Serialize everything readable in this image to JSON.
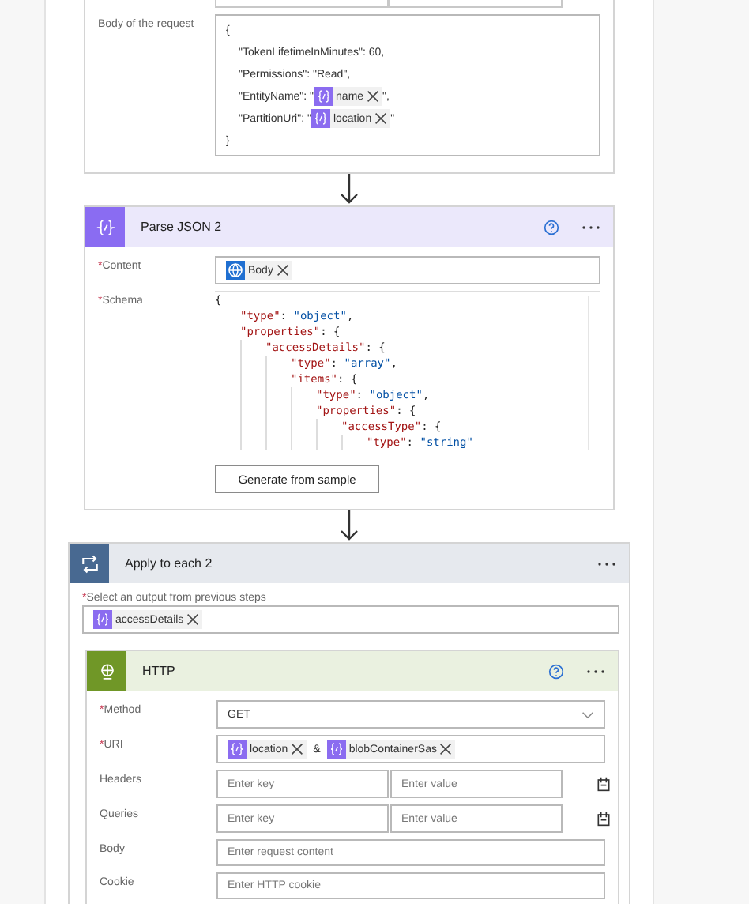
{
  "request_body": {
    "label": "Body of the request",
    "open": "{",
    "close": "}",
    "entries": [
      [
        {
          "kind": "text",
          "text": "\"TokenLifetimeInMinutes\": 60,"
        }
      ],
      [
        {
          "kind": "text",
          "text": "\"Permissions\": \"Read\","
        }
      ],
      [
        {
          "kind": "text",
          "text": "\"EntityName\": \""
        },
        {
          "kind": "expression",
          "text": "name"
        },
        {
          "kind": "text",
          "text": "\","
        }
      ],
      [
        {
          "kind": "text",
          "text": "\"PartitionUri\": \""
        },
        {
          "kind": "expression",
          "text": "location"
        },
        {
          "kind": "text",
          "text": "\""
        }
      ]
    ]
  },
  "parse_json": {
    "title": "Parse JSON 2",
    "button": "Generate from sample",
    "fields": [
      {
        "kind": "tokens",
        "label": "Content",
        "required_mark": "*",
        "parts": [
          {
            "kind": "globe",
            "text": "Body"
          }
        ]
      },
      {
        "kind": "code",
        "label": "Schema",
        "required_mark": "*",
        "tree": [
          {
            "parts": [
              {
                "kind": "punct",
                "text": "{"
              }
            ],
            "children": [
              {
                "parts": [
                  {
                    "kind": "key",
                    "text": "\"type\""
                  },
                  {
                    "kind": "punct",
                    "text": ": "
                  },
                  {
                    "kind": "value",
                    "text": "\"object\""
                  },
                  {
                    "kind": "punct",
                    "text": ","
                  }
                ]
              },
              {
                "parts": [
                  {
                    "kind": "key",
                    "text": "\"properties\""
                  },
                  {
                    "kind": "punct",
                    "text": ": {"
                  }
                ],
                "children": [
                  {
                    "parts": [
                      {
                        "kind": "key",
                        "text": "\"accessDetails\""
                      },
                      {
                        "kind": "punct",
                        "text": ": {"
                      }
                    ],
                    "children": [
                      {
                        "parts": [
                          {
                            "kind": "key",
                            "text": "\"type\""
                          },
                          {
                            "kind": "punct",
                            "text": ": "
                          },
                          {
                            "kind": "value",
                            "text": "\"array\""
                          },
                          {
                            "kind": "punct",
                            "text": ","
                          }
                        ]
                      },
                      {
                        "parts": [
                          {
                            "kind": "key",
                            "text": "\"items\""
                          },
                          {
                            "kind": "punct",
                            "text": ": {"
                          }
                        ],
                        "children": [
                          {
                            "parts": [
                              {
                                "kind": "key",
                                "text": "\"type\""
                              },
                              {
                                "kind": "punct",
                                "text": ": "
                              },
                              {
                                "kind": "value",
                                "text": "\"object\""
                              },
                              {
                                "kind": "punct",
                                "text": ","
                              }
                            ]
                          },
                          {
                            "parts": [
                              {
                                "kind": "key",
                                "text": "\"properties\""
                              },
                              {
                                "kind": "punct",
                                "text": ": {"
                              }
                            ],
                            "children": [
                              {
                                "parts": [
                                  {
                                    "kind": "key",
                                    "text": "\"accessType\""
                                  },
                                  {
                                    "kind": "punct",
                                    "text": ": {"
                                  }
                                ],
                                "children": [
                                  {
                                    "parts": [
                                      {
                                        "kind": "key",
                                        "text": "\"type\""
                                      },
                                      {
                                        "kind": "punct",
                                        "text": ": "
                                      },
                                      {
                                        "kind": "value",
                                        "text": "\"string\""
                                      }
                                    ]
                                  }
                                ]
                              }
                            ]
                          }
                        ]
                      }
                    ]
                  }
                ]
              }
            ]
          }
        ]
      }
    ]
  },
  "apply_each": {
    "title": "Apply to each 2",
    "select_label": "Select an output from previous steps",
    "required_mark": "*",
    "parts": [
      {
        "kind": "expression",
        "text": "accessDetails"
      }
    ]
  },
  "http": {
    "title": "HTTP",
    "fields": [
      {
        "kind": "select",
        "label": "Method",
        "required_mark": "*",
        "value": "GET"
      },
      {
        "kind": "tokens",
        "label": "URI",
        "required_mark": "*",
        "parts": [
          {
            "kind": "expression",
            "text": "location"
          },
          {
            "kind": "text",
            "text": "&"
          },
          {
            "kind": "expression",
            "text": "blobContainerSas"
          }
        ]
      },
      {
        "kind": "keyvalue",
        "label": "Headers",
        "key_placeholder": "Enter key",
        "value_placeholder": "Enter value"
      },
      {
        "kind": "keyvalue",
        "label": "Queries",
        "key_placeholder": "Enter key",
        "value_placeholder": "Enter value"
      },
      {
        "kind": "text",
        "label": "Body",
        "placeholder": "Enter request content"
      },
      {
        "kind": "text",
        "label": "Cookie",
        "placeholder": "Enter HTTP cookie"
      }
    ]
  }
}
